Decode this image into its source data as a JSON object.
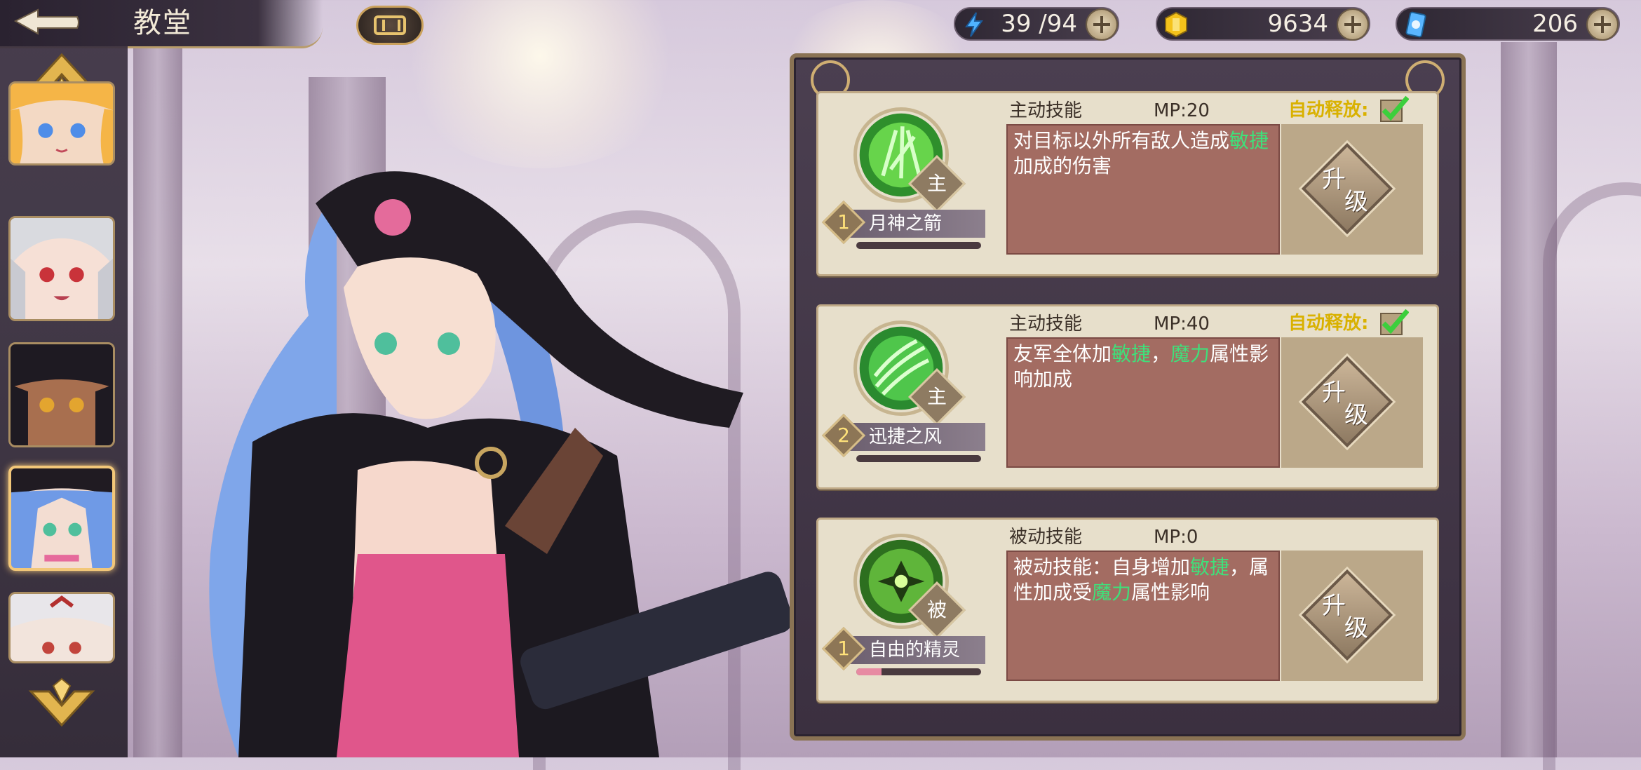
{
  "header": {
    "title": "教堂",
    "resources": [
      {
        "icon": "energy-icon",
        "value": "39 /94"
      },
      {
        "icon": "gold-coin-icon",
        "value": "9634"
      },
      {
        "icon": "card-ticket-icon",
        "value": "206"
      }
    ]
  },
  "colors": {
    "highlight_green": "#3fe07a",
    "auto_yellow": "#d9b100",
    "description_bg": "#a36c62",
    "card_bg": "#e7dfcb"
  },
  "heroes": {
    "selected_index": 3,
    "count_visible": 5
  },
  "skills": [
    {
      "type": "主动技能",
      "mp": "MP:20",
      "auto_label": "自动释放:",
      "auto_enabled": true,
      "badge": "主",
      "level": "1",
      "name": "月神之箭",
      "xp_fraction": 0.0,
      "desc_parts": [
        "对目标以外所有敌人造成",
        "敏捷",
        "加成的伤害"
      ],
      "upgrade_a": "升",
      "upgrade_b": "级"
    },
    {
      "type": "主动技能",
      "mp": "MP:40",
      "auto_label": "自动释放:",
      "auto_enabled": true,
      "badge": "主",
      "level": "2",
      "name": "迅捷之风",
      "xp_fraction": 0.0,
      "desc_parts": [
        "友军全体加",
        "敏捷",
        "，",
        "魔力",
        "属性影响加成"
      ],
      "upgrade_a": "升",
      "upgrade_b": "级"
    },
    {
      "type": "被动技能",
      "mp": "MP:0",
      "auto_label": "",
      "auto_enabled": false,
      "badge": "被",
      "level": "1",
      "name": "自由的精灵",
      "xp_fraction": 0.2,
      "desc_parts": [
        "被动技能：自身增加",
        "敏捷",
        "，属性加成受",
        "魔力",
        "属性影响"
      ],
      "upgrade_a": "升",
      "upgrade_b": "级"
    }
  ]
}
